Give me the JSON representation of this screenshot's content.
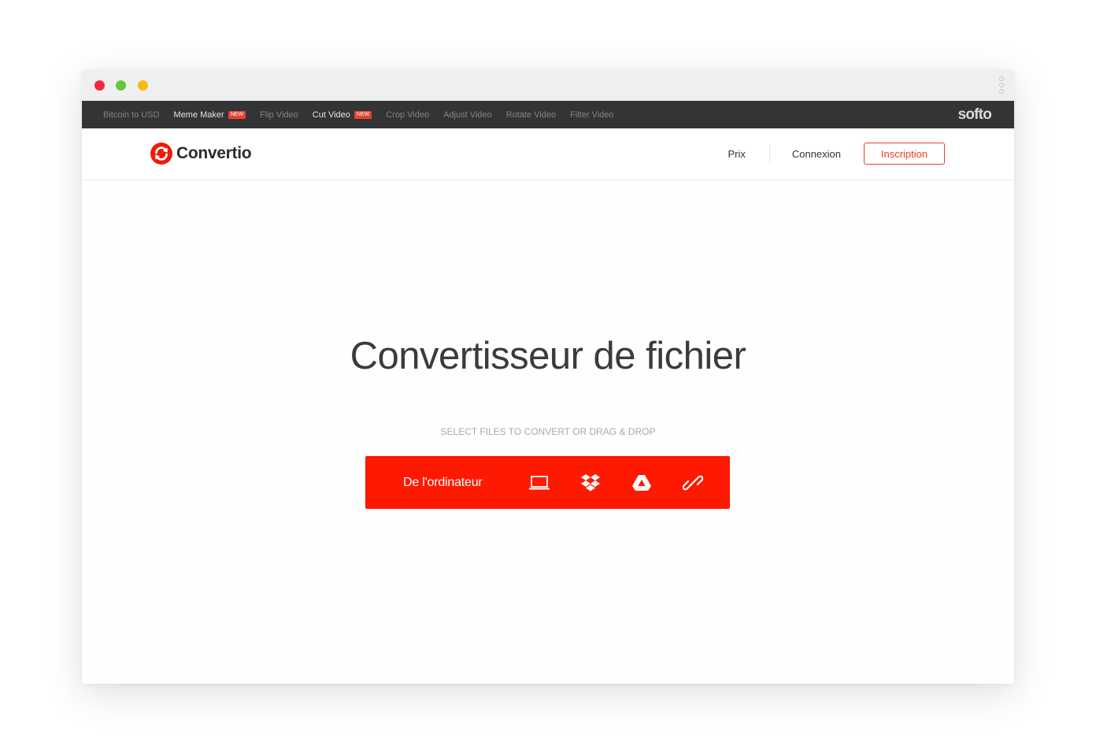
{
  "topbar": {
    "links": [
      {
        "label": "Bitcoin to USD",
        "badge": ""
      },
      {
        "label": "Meme Maker",
        "badge": "NEW"
      },
      {
        "label": "Flip Video",
        "badge": ""
      },
      {
        "label": "Cut Video",
        "badge": "NEW"
      },
      {
        "label": "Crop Video",
        "badge": ""
      },
      {
        "label": "Adjust Video",
        "badge": ""
      },
      {
        "label": "Rotate Video",
        "badge": ""
      },
      {
        "label": "Filter Video",
        "badge": ""
      }
    ],
    "brand": "softo"
  },
  "header": {
    "logo_text": "Convertio",
    "nav": {
      "pricing": "Prix",
      "login": "Connexion",
      "signup": "Inscription"
    }
  },
  "main": {
    "title": "Convertisseur de fichier",
    "hint": "SELECT FILES TO CONVERT OR DRAG & DROP",
    "upload_label": "De l'ordinateur"
  },
  "colors": {
    "accent": "#fd1902",
    "topbar_bg": "#333435",
    "badge": "#e8412d"
  },
  "icons": [
    "laptop-icon",
    "dropbox-icon",
    "google-drive-icon",
    "url-link-icon"
  ]
}
